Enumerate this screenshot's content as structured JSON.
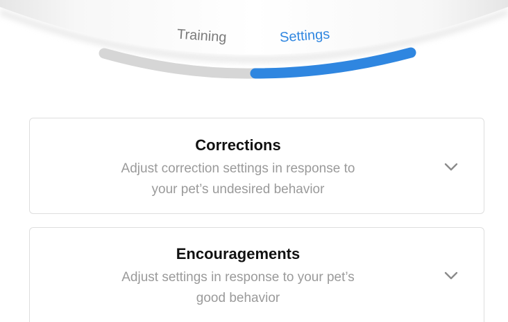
{
  "tabs": {
    "training_label": "Training",
    "settings_label": "Settings",
    "active": "Settings"
  },
  "cards": [
    {
      "title": "Corrections",
      "description_line1": "Adjust correction settings in response to",
      "description_line2": "your pet’s undesired behavior",
      "icon": "chevron-down-icon"
    },
    {
      "title": "Encouragements",
      "description_line1": "Adjust settings in response to your pet’s",
      "description_line2": "good behavior",
      "icon": "chevron-down-icon"
    }
  ],
  "colors": {
    "accent": "#2f86e0",
    "inactive_track": "#d6d6d6",
    "title_text": "#111111",
    "description_text": "#9a9a9a",
    "card_border": "#dedede"
  }
}
